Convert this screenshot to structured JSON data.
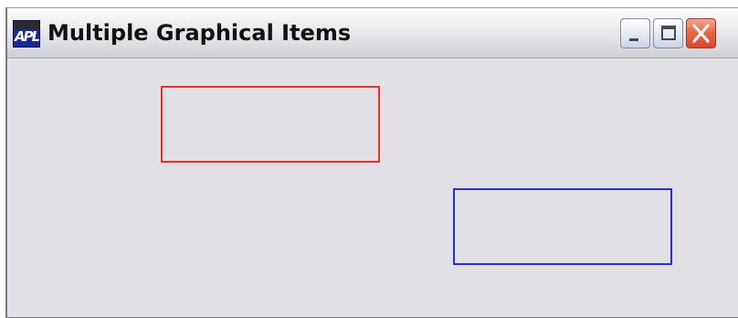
{
  "window": {
    "title": "Multiple Graphical Items",
    "app_icon": {
      "name": "apl-app-icon",
      "glyph": "APL"
    },
    "controls": [
      {
        "name": "minimize-button",
        "icon": "minimize-icon"
      },
      {
        "name": "maximize-button",
        "icon": "maximize-icon"
      },
      {
        "name": "close-button",
        "icon": "close-icon"
      }
    ]
  },
  "canvas": {
    "items": [
      {
        "name": "red-rectangle",
        "shape": "rectangle",
        "color": "#ee2a2a"
      },
      {
        "name": "blue-rectangle",
        "shape": "rectangle",
        "color": "#2b2bee"
      }
    ],
    "background": "#e1e0e5"
  }
}
